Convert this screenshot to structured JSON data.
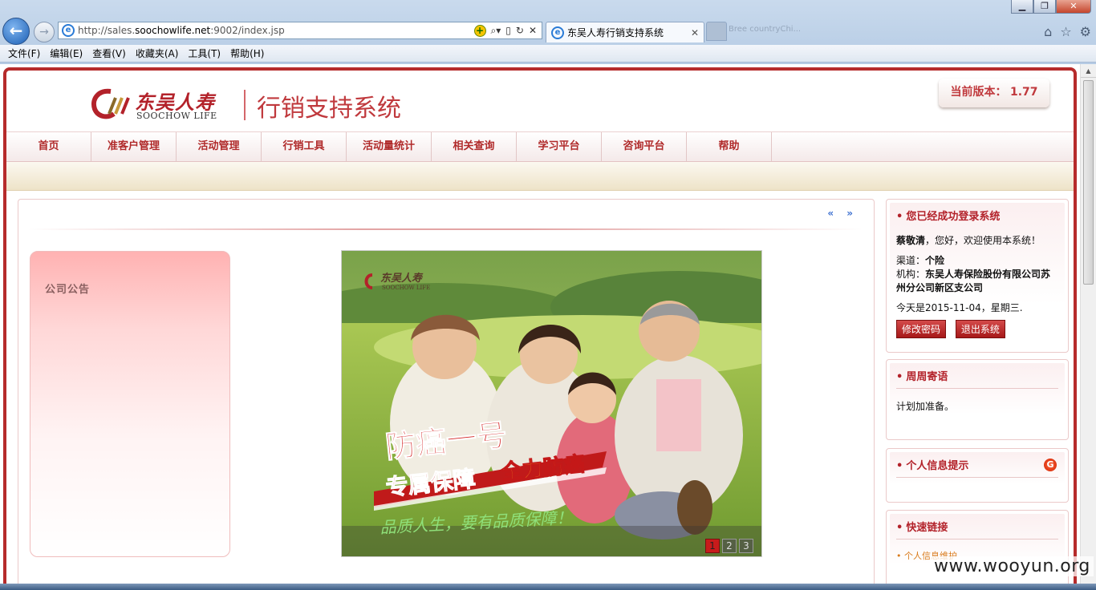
{
  "browser": {
    "url_prefix": "http://sales.",
    "url_domain": "soochowlife.net",
    "url_suffix": ":9002/index.jsp",
    "tab_title": "东吴人寿行销支持系统",
    "blurred_tab": "Bree countryChi...",
    "menu": [
      "文件(F)",
      "编辑(E)",
      "查看(V)",
      "收藏夹(A)",
      "工具(T)",
      "帮助(H)"
    ]
  },
  "header": {
    "logo_cn": "东吴人寿",
    "logo_en": "SOOCHOW LIFE",
    "system_title": "行销支持系统",
    "version_label": "当前版本：",
    "version_value": "1.77"
  },
  "nav": [
    "首页",
    "准客户管理",
    "活动管理",
    "行销工具",
    "活动量统计",
    "相关查询",
    "学习平台",
    "咨询平台",
    "帮助"
  ],
  "main": {
    "arrows": "« »",
    "notice_title": "公司公告",
    "banner": {
      "logo_cn": "东吴人寿",
      "logo_en": "SOOCHOW LIFE",
      "headline": "防癌一号",
      "tag1": "专属保障",
      "tag2": "全力防癌",
      "slogan": "品质人生，要有品质保障！",
      "pages": [
        "1",
        "2",
        "3"
      ],
      "active_page": 1
    }
  },
  "side": {
    "login": {
      "title": "您已经成功登录系统",
      "user": "蔡敬清",
      "greeting": "，您好，欢迎使用本系统！",
      "channel_label": "渠道：",
      "channel": "个险",
      "org_label": "机构：",
      "org": "东吴人寿保险股份有限公司苏州分公司新区支公司",
      "date_text": "今天是2015-11-04，星期三.",
      "change_pwd": "修改密码",
      "logout": "退出系统"
    },
    "weekly": {
      "title": "周周寄语",
      "text": "计划加准备。"
    },
    "personal": {
      "title": "个人信息提示"
    },
    "links": {
      "title": "快速链接",
      "item1": "个人信息维护"
    }
  },
  "watermark": "www.wooyun.org",
  "colors": {
    "brand_red": "#b3222a",
    "frame_red": "#b62b2b",
    "link_orange": "#d97b1c"
  }
}
